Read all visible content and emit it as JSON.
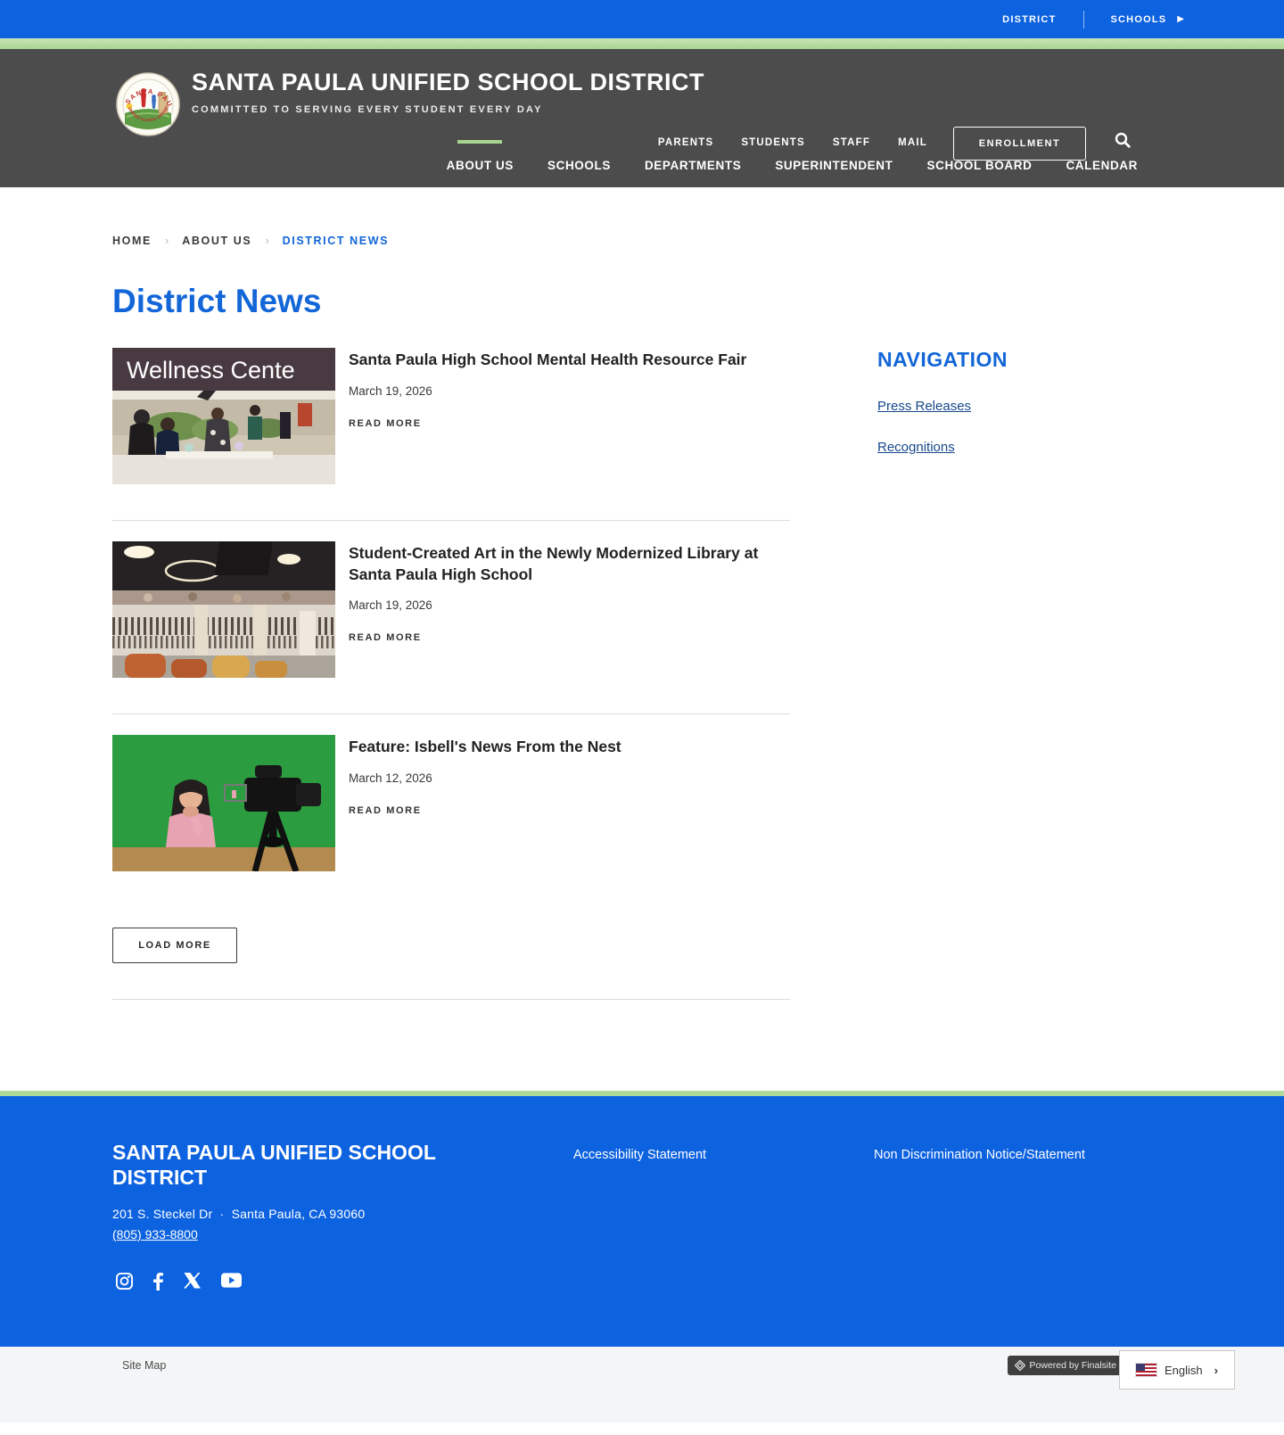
{
  "topbar": {
    "district": "DISTRICT",
    "schools": "SCHOOLS"
  },
  "header": {
    "title": "SANTA PAULA UNIFIED SCHOOL DISTRICT",
    "tagline": "COMMITTED TO SERVING EVERY STUDENT EVERY DAY",
    "utility": {
      "parents": "PARENTS",
      "students": "STUDENTS",
      "staff": "STAFF",
      "mail": "MAIL"
    },
    "enrollment_label": "ENROLLMENT",
    "nav": [
      {
        "label": "ABOUT US",
        "active": true
      },
      {
        "label": "SCHOOLS"
      },
      {
        "label": "DEPARTMENTS"
      },
      {
        "label": "SUPERINTENDENT"
      },
      {
        "label": "SCHOOL BOARD"
      },
      {
        "label": "CALENDAR"
      }
    ]
  },
  "breadcrumb": {
    "home": "HOME",
    "about": "ABOUT US",
    "current": "DISTRICT NEWS"
  },
  "page": {
    "title": "District News"
  },
  "news": [
    {
      "title": "Santa Paula High School Mental Health Resource Fair",
      "date": "March 19, 2026",
      "read_more": "READ MORE",
      "image": "wellness-center-fair-photo",
      "banner_text": "Wellness Cente"
    },
    {
      "title": "Student-Created Art in the Newly Modernized Library at Santa Paula High School",
      "date": "March 19, 2026",
      "read_more": "READ MORE",
      "image": "modernized-library-photo"
    },
    {
      "title": "Feature: Isbell's News From the Nest",
      "date": "March 12, 2026",
      "read_more": "READ MORE",
      "image": "green-screen-studio-photo"
    }
  ],
  "load_more_label": "LOAD MORE",
  "sidebar": {
    "title": "NAVIGATION",
    "links": [
      {
        "label": "Press Releases"
      },
      {
        "label": "Recognitions"
      }
    ]
  },
  "footer": {
    "district_name": "SANTA PAULA UNIFIED SCHOOL DISTRICT",
    "address": "201 S. Steckel Dr",
    "address_sep": "·",
    "city": "Santa Paula, CA  93060",
    "phone": "(805) 933-8800",
    "link_accessibility": "Accessibility Statement",
    "link_nondiscrimination": "Non Discrimination Notice/Statement",
    "social": [
      "instagram",
      "facebook",
      "x-twitter",
      "youtube"
    ]
  },
  "bottombar": {
    "sitemap": "Site Map",
    "powered_by": "Powered by Finalsite",
    "language": "English"
  },
  "colors": {
    "brand_blue": "#0d62e0",
    "link_blue": "#1266d8",
    "accent_green": "#a9d58f",
    "header_gray": "#4c4c4c",
    "sidebar_link": "#17498c"
  }
}
